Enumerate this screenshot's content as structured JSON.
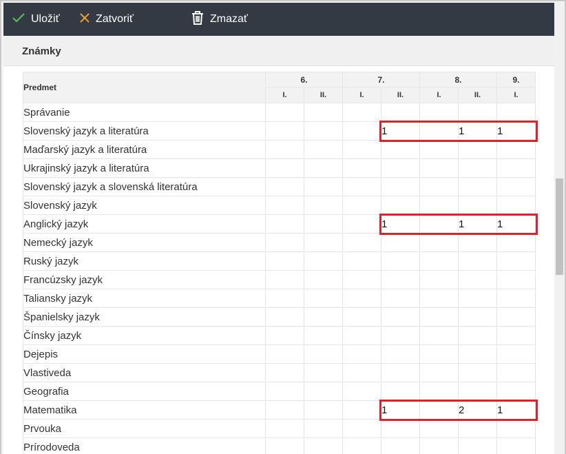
{
  "toolbar": {
    "save_label": "Uložiť",
    "close_label": "Zatvoriť",
    "delete_label": "Zmazať",
    "save_icon": "check-icon",
    "close_icon": "close-icon",
    "delete_icon": "trash-icon",
    "save_icon_color": "#5cb85c",
    "close_icon_color": "#f0a030"
  },
  "section": {
    "title": "Známky"
  },
  "table": {
    "subject_header": "Predmet",
    "years": [
      {
        "label": "6.",
        "semesters": [
          "I.",
          "II."
        ]
      },
      {
        "label": "7.",
        "semesters": [
          "I.",
          "II."
        ]
      },
      {
        "label": "8.",
        "semesters": [
          "I.",
          "II."
        ]
      },
      {
        "label": "9.",
        "semesters": [
          "I."
        ]
      }
    ],
    "rows": [
      {
        "subject": "Správanie",
        "grades": [
          "",
          "",
          "",
          "",
          "",
          "",
          ""
        ],
        "highlighted": false
      },
      {
        "subject": "Slovenský jazyk a literatúra",
        "grades": [
          "",
          "",
          "",
          "1",
          "",
          "1",
          "1"
        ],
        "highlighted": true
      },
      {
        "subject": "Maďarský jazyk a literatúra",
        "grades": [
          "",
          "",
          "",
          "",
          "",
          "",
          ""
        ],
        "highlighted": false
      },
      {
        "subject": "Ukrajinský jazyk a literatúra",
        "grades": [
          "",
          "",
          "",
          "",
          "",
          "",
          ""
        ],
        "highlighted": false
      },
      {
        "subject": "Slovenský jazyk a slovenská literatúra",
        "grades": [
          "",
          "",
          "",
          "",
          "",
          "",
          ""
        ],
        "highlighted": false
      },
      {
        "subject": "Slovenský jazyk",
        "grades": [
          "",
          "",
          "",
          "",
          "",
          "",
          ""
        ],
        "highlighted": false
      },
      {
        "subject": "Anglický jazyk",
        "grades": [
          "",
          "",
          "",
          "1",
          "",
          "1",
          "1"
        ],
        "highlighted": true
      },
      {
        "subject": "Nemecký jazyk",
        "grades": [
          "",
          "",
          "",
          "",
          "",
          "",
          ""
        ],
        "highlighted": false
      },
      {
        "subject": "Ruský jazyk",
        "grades": [
          "",
          "",
          "",
          "",
          "",
          "",
          ""
        ],
        "highlighted": false
      },
      {
        "subject": "Francúzsky jazyk",
        "grades": [
          "",
          "",
          "",
          "",
          "",
          "",
          ""
        ],
        "highlighted": false
      },
      {
        "subject": "Taliansky jazyk",
        "grades": [
          "",
          "",
          "",
          "",
          "",
          "",
          ""
        ],
        "highlighted": false
      },
      {
        "subject": "Španielsky jazyk",
        "grades": [
          "",
          "",
          "",
          "",
          "",
          "",
          ""
        ],
        "highlighted": false
      },
      {
        "subject": "Čínsky jazyk",
        "grades": [
          "",
          "",
          "",
          "",
          "",
          "",
          ""
        ],
        "highlighted": false
      },
      {
        "subject": "Dejepis",
        "grades": [
          "",
          "",
          "",
          "",
          "",
          "",
          ""
        ],
        "highlighted": false
      },
      {
        "subject": "Vlastiveda",
        "grades": [
          "",
          "",
          "",
          "",
          "",
          "",
          ""
        ],
        "highlighted": false
      },
      {
        "subject": "Geografia",
        "grades": [
          "",
          "",
          "",
          "",
          "",
          "",
          ""
        ],
        "highlighted": false
      },
      {
        "subject": "Matematika",
        "grades": [
          "",
          "",
          "",
          "1",
          "",
          "2",
          "1"
        ],
        "highlighted": true
      },
      {
        "subject": "Prvouka",
        "grades": [
          "",
          "",
          "",
          "",
          "",
          "",
          ""
        ],
        "highlighted": false
      },
      {
        "subject": "Prírodoveda",
        "grades": [
          "",
          "",
          "",
          "",
          "",
          "",
          ""
        ],
        "highlighted": false
      }
    ],
    "highlight_color": "#e0202a"
  }
}
